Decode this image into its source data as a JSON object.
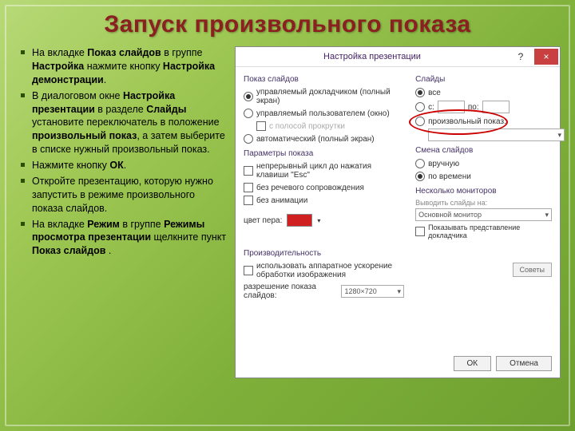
{
  "title": "Запуск произвольного показа",
  "bullets": [
    {
      "pre": "На вкладке ",
      "b1": "Показ слайдов",
      "mid1": " в группе ",
      "b2": "Настройка",
      "mid2": " нажмите кнопку ",
      "b3": "Настройка демонстрации",
      "post": "."
    },
    {
      "pre": "В диалоговом окне ",
      "b1": "Настройка презентации",
      "mid1": " в разделе ",
      "b2": "Слайды",
      "mid2": " установите переключатель в положение ",
      "b3": "произвольный показ",
      "post": ", а затем выберите в списке нужный произвольный показ."
    },
    {
      "pre": "Нажмите кнопку ",
      "b1": "ОК",
      "post": "."
    },
    {
      "pre": "Откройте презентацию, которую нужно запустить в режиме произвольного показа слайдов.",
      "b1": "",
      "post": ""
    },
    {
      "pre": "На вкладке ",
      "b1": "Режим",
      "mid1": " в группе ",
      "b2": "Режимы просмотра презентации",
      "mid2": " щелкните пункт ",
      "b3": "Показ слайдов",
      "post": " ."
    }
  ],
  "dlg": {
    "title": "Настройка презентации",
    "help": "?",
    "close": "×",
    "grp_show": "Показ слайдов",
    "r1": "управляемый докладчиком (полный экран)",
    "r2": "управляемый пользователем (окно)",
    "chk_scroll": "с полосой прокрутки",
    "r3": "автоматический (полный экран)",
    "grp_params": "Параметры показа",
    "chk_loop": "непрерывный цикл до нажатия клавиши \"Esc\"",
    "chk_nosnd": "без речевого сопровождения",
    "chk_noanim": "без анимации",
    "pen_label": "цвет пера:",
    "grp_perf": "Производительность",
    "chk_hw": "использовать аппаратное ускорение обработки изображения",
    "res_label": "разрешение показа слайдов:",
    "res_val": "1280×720",
    "grp_slides": "Слайды",
    "s_all": "все",
    "s_from": "с:",
    "s_to": "по:",
    "s_custom": "произвольный показ:",
    "grp_change": "Смена слайдов",
    "c_manual": "вручную",
    "c_time": "по времени",
    "grp_mon": "Несколько мониторов",
    "mon_label": "Выводить слайды на:",
    "mon_val": "Основной монитор",
    "chk_presenter": "Показывать представление докладчика",
    "btn_tips": "Советы",
    "btn_ok": "ОК",
    "btn_cancel": "Отмена"
  }
}
